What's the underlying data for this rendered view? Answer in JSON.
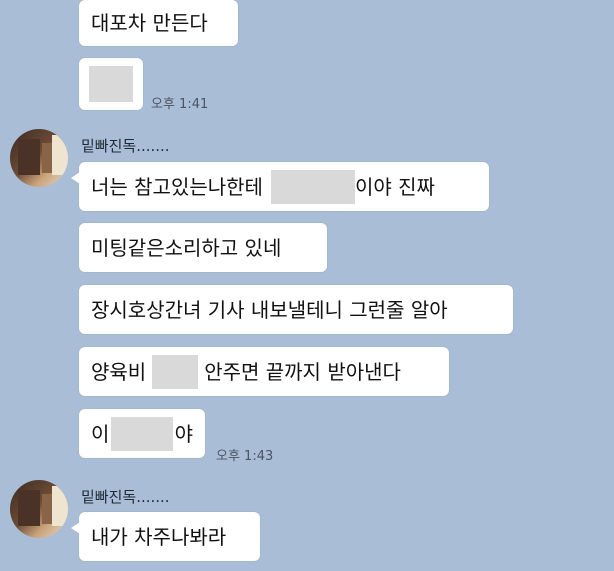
{
  "colors": {
    "background": "#a9bdd6",
    "bubble": "#ffffff",
    "redaction": "#d9d9d9"
  },
  "messages": {
    "m1": "대포차 만든다",
    "t1": "오후 1:41",
    "sender1": "밑빠진독.......",
    "m3_pre": "너는 참고있는나한테",
    "m3_post": "이야 진짜",
    "m4": "미팅같은소리하고 있네",
    "m5": "장시호상간녀 기사 내보낼테니 그런줄 알아",
    "m6_pre": "양육비",
    "m6_post": "안주면 끝까지 받아낸다",
    "m7_pre": "이",
    "m7_post": "야",
    "t2": "오후 1:43",
    "sender2": "밑빠진독.......",
    "m8": "내가 차주나봐라"
  }
}
